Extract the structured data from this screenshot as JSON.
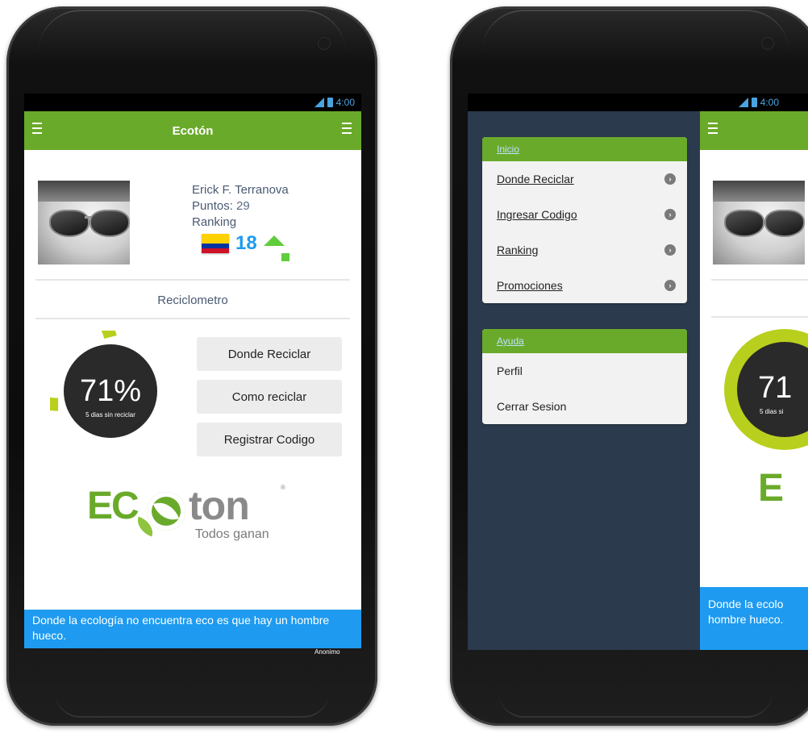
{
  "status": {
    "time": "4:00"
  },
  "app": {
    "title": "Ecotón"
  },
  "profile": {
    "name": "Erick F. Terranova",
    "points_label": "Puntos:",
    "points_value": "29",
    "ranking_label": "Ranking",
    "ranking_value": "18"
  },
  "section_title": "Reciclometro",
  "meter": {
    "percent_text": "71%",
    "subtitle": "5 dias sin reciclar",
    "percent": 71
  },
  "actions": [
    "Donde Reciclar",
    "Como reciclar",
    "Registrar Codigo"
  ],
  "logo": {
    "prefix": "EC",
    "suffix": "ton",
    "tagline": "Todos ganan"
  },
  "quote": {
    "text": "Donde la ecología no encuentra eco es que hay un hombre hueco.",
    "author": "Anonimo"
  },
  "drawer": {
    "main_header": "Inicio",
    "main_items": [
      "Donde Reciclar",
      "Ingresar Codigo",
      "Ranking",
      "Promociones"
    ],
    "help_header": "Ayuda",
    "help_items": [
      "Perfil",
      "Cerrar Sesion"
    ]
  },
  "peek": {
    "percent_text": "71",
    "subtitle": "5 dias si",
    "logo_prefix": "E",
    "quote_text": "Donde la ecolo hombre hueco."
  },
  "colors": {
    "green": "#6aaa2a",
    "lime": "#b9cf1e",
    "blue": "#1e9bf0",
    "drawer": "#2b3a4d",
    "status": "#4aa3e0"
  }
}
